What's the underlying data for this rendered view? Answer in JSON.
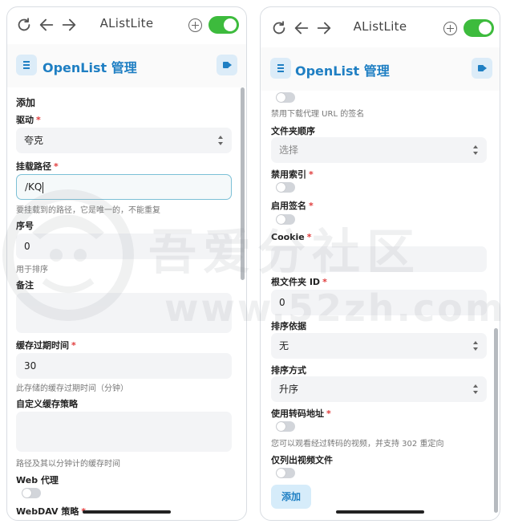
{
  "app": {
    "title": "AListLite"
  },
  "header": {
    "title": "OpenList 管理"
  },
  "watermark": {
    "text_cn": "吾爱分社区",
    "text_url": "www.52zh.com"
  },
  "left": {
    "section_title": "添加",
    "driver": {
      "label": "驱动",
      "value": "夸克"
    },
    "mount_path": {
      "label": "挂载路径",
      "value": "/KQ",
      "help": "要挂载到的路径，它是唯一的，不能重复"
    },
    "order": {
      "label": "序号",
      "value": "0",
      "help": "用于排序"
    },
    "remark": {
      "label": "备注",
      "value": ""
    },
    "cache_expiration": {
      "label": "缓存过期时间",
      "value": "30",
      "help": "此存储的缓存过期时间（分钟）"
    },
    "custom_cache_policy": {
      "label": "自定义缓存策略",
      "value": "",
      "help": "路径及其以分钟计的缓存时间"
    },
    "web_proxy": {
      "label": "Web 代理",
      "enabled": false
    },
    "webdav_policy": {
      "label": "WebDAV 策略"
    }
  },
  "right": {
    "disable_proxy_sign": {
      "help": "禁用下载代理 URL 的签名",
      "enabled": false
    },
    "folder_order": {
      "label": "文件夹顺序",
      "placeholder": "选择"
    },
    "disable_index": {
      "label": "禁用索引",
      "enabled": false
    },
    "enable_sign": {
      "label": "启用签名",
      "enabled": false
    },
    "cookie": {
      "label": "Cookie",
      "value": ""
    },
    "root_folder_id": {
      "label": "根文件夹 ID",
      "value": "0"
    },
    "order_by": {
      "label": "排序依据",
      "value": "无"
    },
    "order_direction": {
      "label": "排序方式",
      "value": "升序"
    },
    "use_transcoding": {
      "label": "使用转码地址",
      "help": "您可以观看经过转码的视频，并支持 302 重定向",
      "enabled": false
    },
    "only_video": {
      "label": "仅列出视频文件",
      "enabled": false
    },
    "add_button": "添加"
  },
  "colors": {
    "accent": "#1f7fc3",
    "toggle_on": "#3dbb3d",
    "required": "#e03b3b"
  }
}
